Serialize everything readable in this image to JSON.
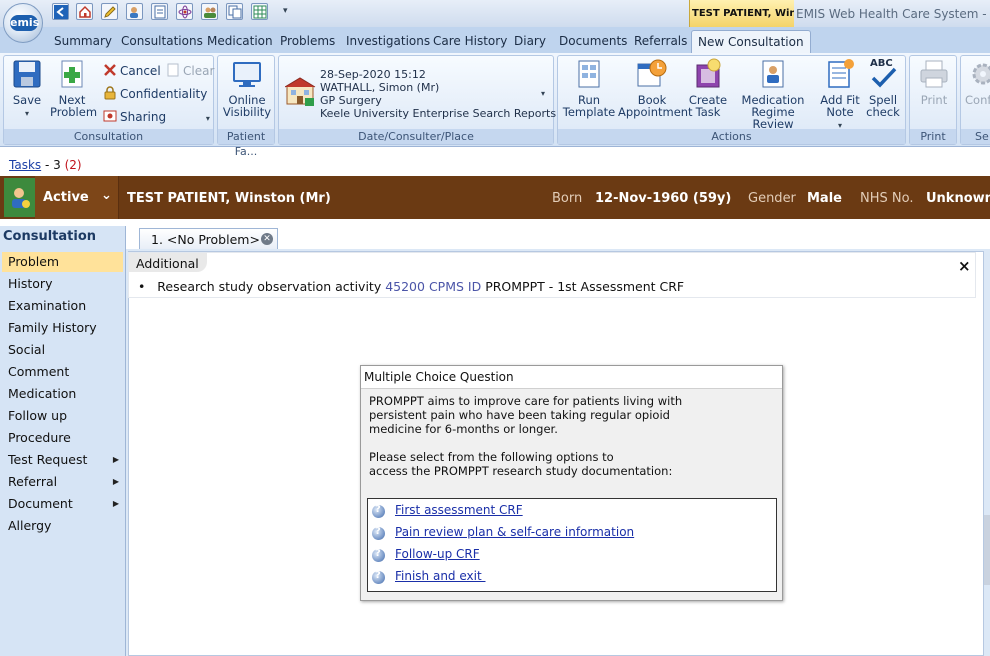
{
  "app": {
    "logo_text": "emis",
    "title": "EMIS Web Health Care System - Keele",
    "patient_tab_title": "TEST PATIENT, Winst"
  },
  "ribbon_tabs": [
    "Summary",
    "Consultations",
    "Medication",
    "Problems",
    "Investigations",
    "Care History",
    "Diary",
    "Documents",
    "Referrals"
  ],
  "ribbon_active_tab": "New Consultation",
  "ribbon": {
    "save": "Save",
    "next_problem": [
      "Next",
      "Problem"
    ],
    "cancel": "Cancel",
    "clear": "Clear",
    "confidentiality": "Confidentiality",
    "sharing": "Sharing",
    "online_visibility": [
      "Online",
      "Visibility"
    ],
    "date_consulter": {
      "date": "28-Sep-2020 15:12",
      "consulter": "WATHALL, Simon (Mr)",
      "place": "GP Surgery",
      "org": "Keele University Enterprise Search  Reports"
    },
    "run_template": [
      "Run",
      "Template"
    ],
    "book_appointment": [
      "Book",
      "Appointment"
    ],
    "create_task": [
      "Create",
      "Task"
    ],
    "medication_review": [
      "Medication",
      "Regime Review"
    ],
    "add_fit_note": [
      "Add Fit",
      "Note"
    ],
    "spell_check": [
      "Spell",
      "check"
    ],
    "spell_abc": "ABC",
    "print": "Print",
    "conf_cut": "Conf",
    "groups": {
      "consultation": "Consultation",
      "patient_facing": "Patient Fa...",
      "date_consulter_place": "Date/Consulter/Place",
      "actions": "Actions",
      "print": "Print",
      "se": "Se"
    }
  },
  "tasks": {
    "label": "Tasks",
    "count_text": " - 3 ",
    "urgent_text": "(2)"
  },
  "banner": {
    "status": "Active",
    "patient_name": "TEST PATIENT,  Winston  (Mr)",
    "born_label": "Born",
    "born_value": "12-Nov-1960 (59y)",
    "gender_label": "Gender",
    "gender_value": "Male",
    "nhs_label": "NHS No.",
    "nhs_value": "Unknown"
  },
  "left_nav": {
    "title": "Consultation",
    "items": [
      {
        "label": "Problem",
        "submenu": false
      },
      {
        "label": "History",
        "submenu": false
      },
      {
        "label": "Examination",
        "submenu": false
      },
      {
        "label": "Family History",
        "submenu": false
      },
      {
        "label": "Social",
        "submenu": false
      },
      {
        "label": "Comment",
        "submenu": false
      },
      {
        "label": "Medication",
        "submenu": false
      },
      {
        "label": "Follow up",
        "submenu": false
      },
      {
        "label": "Procedure",
        "submenu": false
      },
      {
        "label": "Test Request",
        "submenu": true
      },
      {
        "label": "Referral",
        "submenu": true
      },
      {
        "label": "Document",
        "submenu": true
      },
      {
        "label": "Allergy",
        "submenu": false
      }
    ],
    "selected": "Problem"
  },
  "document_tab": "1. <No Problem>",
  "main": {
    "section_header": "Additional",
    "close_symbol": "×",
    "entry_bullet": "•",
    "entry_text": "Research study observation activity ",
    "entry_code": "45200 CPMS ID",
    "entry_suffix": " PROMPPT - 1st Assessment CRF"
  },
  "dialog": {
    "title": "Multiple Choice Question",
    "body": "PROMPPT aims to improve care for patients living with\npersistent pain who have been taking regular opioid\nmedicine for 6-months or longer.\n\nPlease select from the following options to\naccess the PROMPPT research study documentation:",
    "options": [
      "First assessment CRF",
      "Pain review plan & self-care information",
      "Follow-up CRF",
      "Finish and exit "
    ]
  },
  "colors": {
    "banner_bg": "#6b3a13",
    "selected_nav": "#ffe29a",
    "link": "#1a2fa8",
    "tasks_urgent": "#c0141c"
  }
}
